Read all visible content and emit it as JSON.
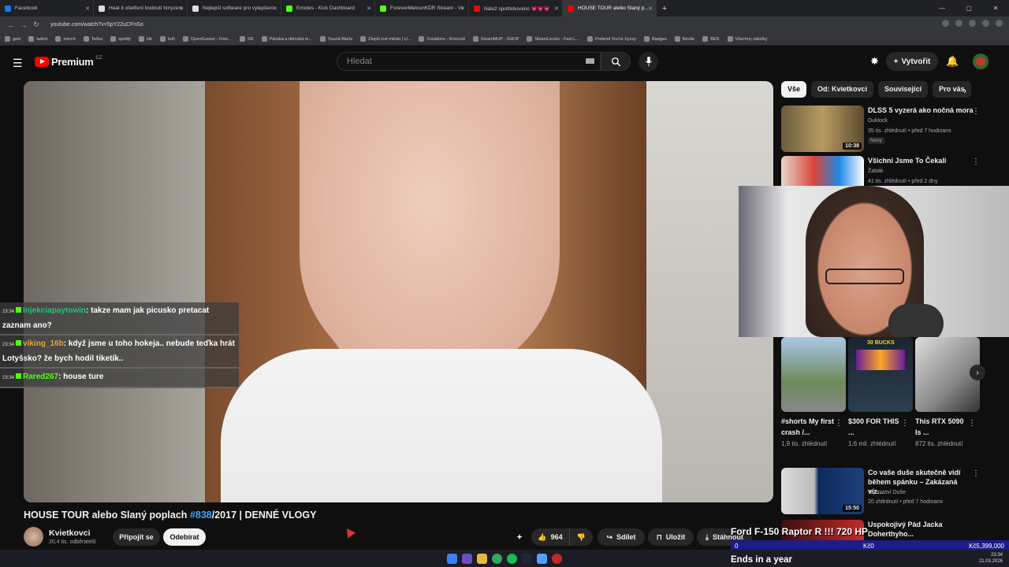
{
  "browser": {
    "tabs": [
      {
        "label": "Facebook",
        "color": "#1877f2"
      },
      {
        "label": "Heat it ošetření bodnutí hmyzem",
        "color": "#dddddd"
      },
      {
        "label": "Nejlepší software pro vylepšení",
        "color": "#dddddd"
      },
      {
        "label": "Emotes - Kick Dashboard",
        "color": "#53fc18"
      },
      {
        "label": "ForeverMelounKDR Stream - Vi",
        "color": "#53fc18"
      },
      {
        "label": "Náloź spotřebováno 💗💗💗",
        "color": "#ff0000"
      },
      {
        "label": "HOUSE TOUR alebo Slaný p...",
        "color": "#ff0000"
      }
    ],
    "url": "youtube.com/watch?v=5pY22uCFnSo",
    "bookmarks": [
      "gsm",
      "twitch",
      "merch",
      "Tečka",
      "spotify",
      "idk",
      "bolt",
      "OpenGuessr - Free...",
      "SR",
      "Pánská a dámská m...",
      "Sound Alerts",
      "Zlepši své město | U...",
      "Creations - Roscoid",
      "SteamMUP - SHOP",
      "SteamLevels - Fast L...",
      "Pretend You're Xyzzy",
      "Badges",
      "Nirvite",
      "BEN",
      "Všechny záložky"
    ]
  },
  "youtube": {
    "logo": "Premium",
    "region": "CZ",
    "search_placeholder": "Hledat",
    "create_label": "Vytvořit"
  },
  "video": {
    "title_prefix": "HOUSE TOUR alebo Slaný poplach ",
    "title_tag": "#838",
    "title_suffix": "/2017 | DENNÉ VLOGY",
    "channel": "Kvietkovci",
    "subscribers": "20,4 tis. odběratelů",
    "join_label": "Připojit se",
    "subscribe_label": "Odebírat",
    "likes": "964",
    "share_label": "Sdílet",
    "save_label": "Uložit",
    "download_label": "Stáhnout"
  },
  "chat": [
    {
      "time": "23:34",
      "user": "Injekciapaytowin",
      "text": ": takze mam jak picusko pretacat zaznam ano?"
    },
    {
      "time": "23:34",
      "user": "viking_16b",
      "text": ": když jsme u toho hokeja.. nebude teďka hrát Lotyšsko? že bych hodil tiketík.."
    },
    {
      "time": "23:34",
      "user": "Rared267",
      "text": ": house ture"
    }
  ],
  "chips": [
    "Vše",
    "Od: Kvietkovci",
    "Související",
    "Pro vás"
  ],
  "recommendations": [
    {
      "title": "DLSS 5 vyzerá ako nočná mora",
      "channel": "Duklock",
      "meta": "35 tis. zhlédnutí • před 7 hodinami",
      "badge": "Nový",
      "duration": "10:38"
    },
    {
      "title": "Všichni Jsme To Čekali",
      "channel": "Žabák",
      "meta": "41 tis. zhlédnutí • před 2 dny"
    },
    {
      "title": "Co vaše duše skutečně vidí během spánku – Zakázaná víz...",
      "channel": "Tajemství Duše",
      "meta": "20 zhlédnutí • před 7 hodinami",
      "duration": "15:50"
    },
    {
      "title": "Uspokojivý Pád Jacka Doherthyho..."
    }
  ],
  "shorts": [
    {
      "title": "#shorts My first crash /...",
      "views": "1,9 tis. zhlédnutí"
    },
    {
      "title": "$300 FOR THIS ...",
      "views": "1,6 mil. zhlédnutí",
      "thumb_text": "30 BUCKS"
    },
    {
      "title": "This RTX 5090 Is ...",
      "views": "872 tis. zhlédnutí"
    }
  ],
  "stream_overlay": {
    "headline": "Ford F-150 Raptor R !!! 720 HP",
    "bar_left": "0",
    "bar_center": "Kč0",
    "bar_right": "Kč5,399,000",
    "subtitle": "Ends in a year"
  },
  "system": {
    "time": "23:34",
    "date": "21.03.2026"
  }
}
